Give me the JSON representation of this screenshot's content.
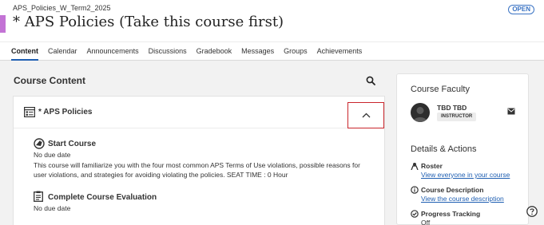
{
  "header": {
    "course_code": "APS_Policies_W_Term2_2025",
    "course_title": "* APS Policies (Take this course first)",
    "status_badge": "OPEN",
    "accent_color": "#c373d5"
  },
  "tabs": [
    {
      "label": "Content",
      "active": true
    },
    {
      "label": "Calendar"
    },
    {
      "label": "Announcements"
    },
    {
      "label": "Discussions"
    },
    {
      "label": "Gradebook"
    },
    {
      "label": "Messages"
    },
    {
      "label": "Groups"
    },
    {
      "label": "Achievements"
    }
  ],
  "course_content": {
    "heading": "Course Content",
    "search_icon": "search-icon",
    "module": {
      "title": "* APS Policies",
      "icon": "module-list-icon",
      "toggle_icon": "chevron-up-icon",
      "items": [
        {
          "title": "Start Course",
          "icon": "start-course-icon",
          "due": "No due date",
          "description": "This course will familiarize you with the four most common APS Terms of Use violations, possible reasons for user violations, and strategies for avoiding violating the policies. SEAT TIME : 0 Hour"
        },
        {
          "title": "Complete Course Evaluation",
          "icon": "clipboard-icon",
          "due": "No due date"
        }
      ]
    }
  },
  "sidebar": {
    "faculty_heading": "Course Faculty",
    "faculty": {
      "name": "TBD TBD",
      "role": "INSTRUCTOR"
    },
    "details_heading": "Details & Actions",
    "actions": [
      {
        "label": "Roster",
        "link": "View everyone in your course",
        "icon": "roster-icon"
      },
      {
        "label": "Course Description",
        "link": "View the course description",
        "icon": "info-icon"
      },
      {
        "label": "Progress Tracking",
        "text": "Off",
        "icon": "check-circle-icon"
      }
    ]
  },
  "colors": {
    "link": "#1f5fb2",
    "highlight_border": "#c9252b",
    "badge_blue": "#3a73c4"
  }
}
